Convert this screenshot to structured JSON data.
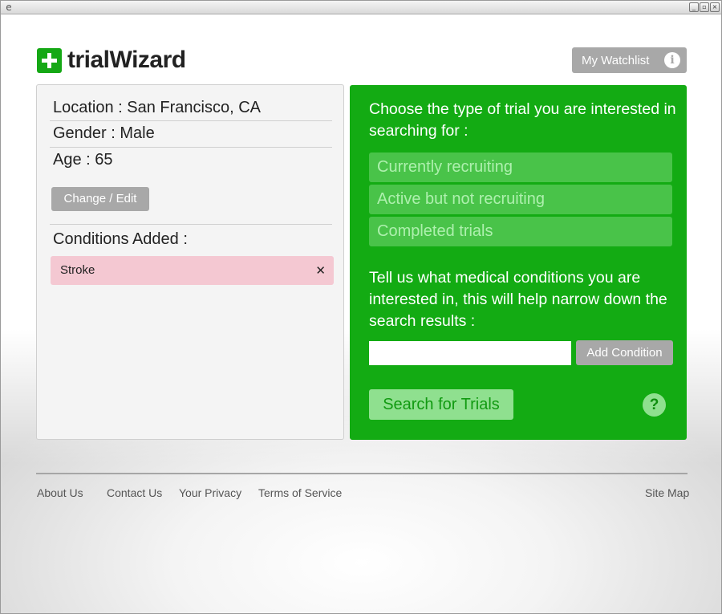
{
  "brand": {
    "name": "trialWizard",
    "accent": "#13ab13"
  },
  "header": {
    "watchlist_label": "My Watchlist",
    "info_icon": "info-icon"
  },
  "profile": {
    "location": "Location : San Francisco, CA",
    "gender": "Gender : Male",
    "age": "Age : 65",
    "change_label": "Change / Edit",
    "conditions_title": "Conditions Added :",
    "conditions": [
      {
        "label": "Stroke",
        "remove_icon": "close-icon"
      }
    ]
  },
  "search": {
    "trial_type_prompt": "Choose the type of trial you are interested in searching for :",
    "trial_types": [
      {
        "label": "Currently recruiting"
      },
      {
        "label": "Active but not recruiting"
      },
      {
        "label": "Completed trials"
      }
    ],
    "conditions_prompt": "Tell us what medical conditions you are interested in, this will help narrow down the search results :",
    "condition_input_value": "",
    "add_condition_label": "Add Condition",
    "search_label": "Search for Trials",
    "help_icon": "help-icon",
    "help_glyph": "?"
  },
  "footer": {
    "links": [
      {
        "label": "About Us"
      },
      {
        "label": "Contact Us"
      },
      {
        "label": "Your Privacy"
      },
      {
        "label": "Terms of Service"
      }
    ],
    "sitemap_label": "Site Map"
  }
}
